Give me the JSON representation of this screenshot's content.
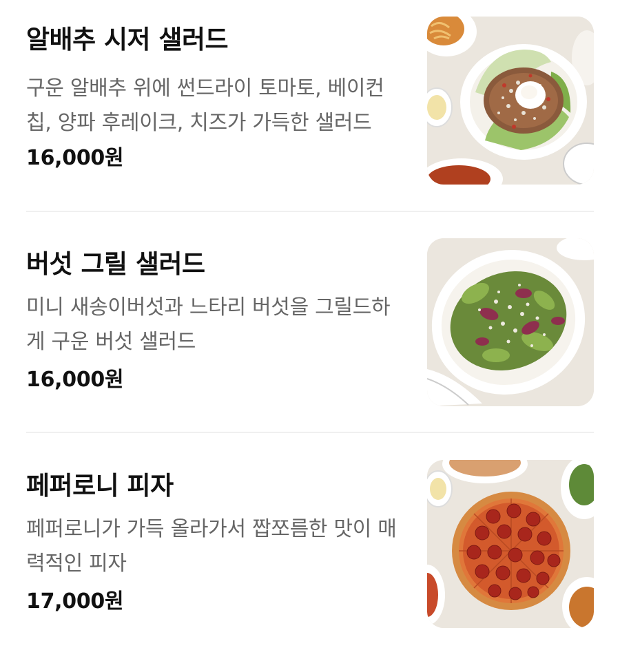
{
  "menu": {
    "items": [
      {
        "name": "알배추 시저 샐러드",
        "description": "구운 알배추 위에 썬드라이 토마토, 베이컨칩, 양파 후레이크, 치즈가 가득한 샐러드",
        "price": "16,000원",
        "image": "cabbage-caesar-salad-photo"
      },
      {
        "name": "버섯 그릴 샐러드",
        "description": "미니 새송이버섯과 느타리 버섯을 그릴드하게 구운 버섯 샐러드",
        "price": "16,000원",
        "image": "mushroom-grill-salad-photo"
      },
      {
        "name": "페퍼로니 피자",
        "description": "페퍼로니가 가득 올라가서 짭쪼름한 맛이 매력적인 피자",
        "price": "17,000원",
        "image": "pepperoni-pizza-photo"
      }
    ]
  },
  "colors": {
    "text_primary": "#111111",
    "text_secondary": "#666666",
    "divider": "#f0f0f0"
  }
}
